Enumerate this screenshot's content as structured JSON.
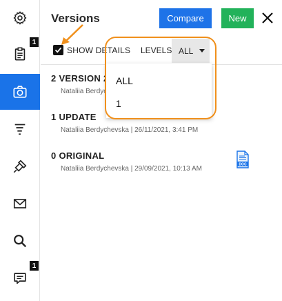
{
  "rail": {
    "items": [
      {
        "icon": "gear-icon",
        "active": false
      },
      {
        "icon": "clipboard-icon",
        "active": false,
        "badge": "1"
      },
      {
        "icon": "camera-icon",
        "active": true
      },
      {
        "icon": "filter-icon",
        "active": false
      },
      {
        "icon": "stamp-icon",
        "active": false
      },
      {
        "icon": "envelope-icon",
        "active": false
      },
      {
        "icon": "search-icon",
        "active": false
      },
      {
        "icon": "comment-icon",
        "active": false,
        "badge": "1"
      }
    ]
  },
  "header": {
    "title": "Versions",
    "compare_label": "Compare",
    "new_label": "New",
    "close_icon": "close-icon"
  },
  "toolbar": {
    "show_details_label": "SHOW DETAILS",
    "show_details_checked": true,
    "levels_label": "LEVELS:",
    "levels_value": "ALL"
  },
  "versions": [
    {
      "number": "2",
      "name": "VERSION 2",
      "author": "Nataliia Berdychevska",
      "date": "",
      "visible_meta": "Nataliia Berdychevska | 2"
    },
    {
      "number": "1",
      "name": "UPDATE",
      "author": "Nataliia Berdychevska",
      "date": "26/11/2021, 3:41 PM",
      "visible_meta": "Nataliia Berdychevska | 26/11/2021, 3:41 PM"
    },
    {
      "number": "0",
      "name": "ORIGINAL",
      "author": "Nataliia Berdychevska",
      "date": "29/09/2021, 10:13 AM",
      "visible_meta": "Nataliia Berdychevska | 29/09/2021, 10:13 AM",
      "file_icon": "doc-file-icon",
      "file_label": "DOC"
    }
  ],
  "levels_dropdown": {
    "options": [
      "ALL",
      "1"
    ]
  },
  "colors": {
    "accent_blue": "#1a73e8",
    "compare_blue": "#1e73e8",
    "new_green": "#22b25a",
    "annotation_orange": "#f0901c"
  }
}
